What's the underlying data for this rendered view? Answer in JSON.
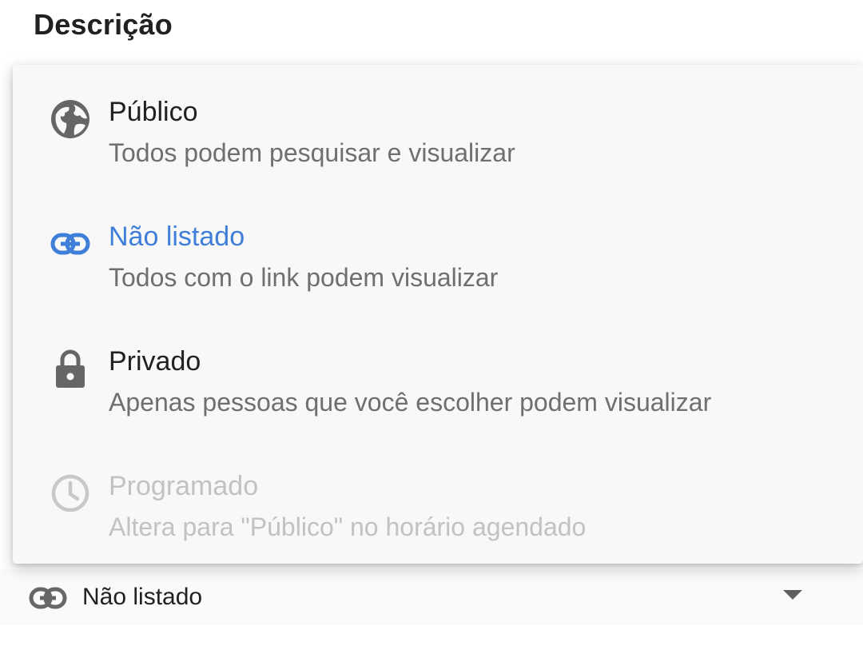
{
  "section": {
    "title": "Descrição"
  },
  "visibility_menu": {
    "items": [
      {
        "title": "Público",
        "description": "Todos podem pesquisar e visualizar",
        "icon": "globe-icon",
        "state": "normal"
      },
      {
        "title": "Não listado",
        "description": "Todos com o link podem visualizar",
        "icon": "link-icon",
        "state": "selected"
      },
      {
        "title": "Privado",
        "description": "Apenas pessoas que você escolher podem visualizar",
        "icon": "lock-icon",
        "state": "normal"
      },
      {
        "title": "Programado",
        "description": "Altera para \"Público\" no horário agendado",
        "icon": "clock-icon",
        "state": "disabled"
      }
    ]
  },
  "visibility_select": {
    "value": "Não listado",
    "icon": "link-icon",
    "dropdown_icon": "chevron-down-icon"
  },
  "colors": {
    "selected": "#3f7fd9",
    "icon": "#666666",
    "disabled": "#c2c2c2",
    "text": "#212121",
    "secondary_text": "#6f6f6f"
  }
}
